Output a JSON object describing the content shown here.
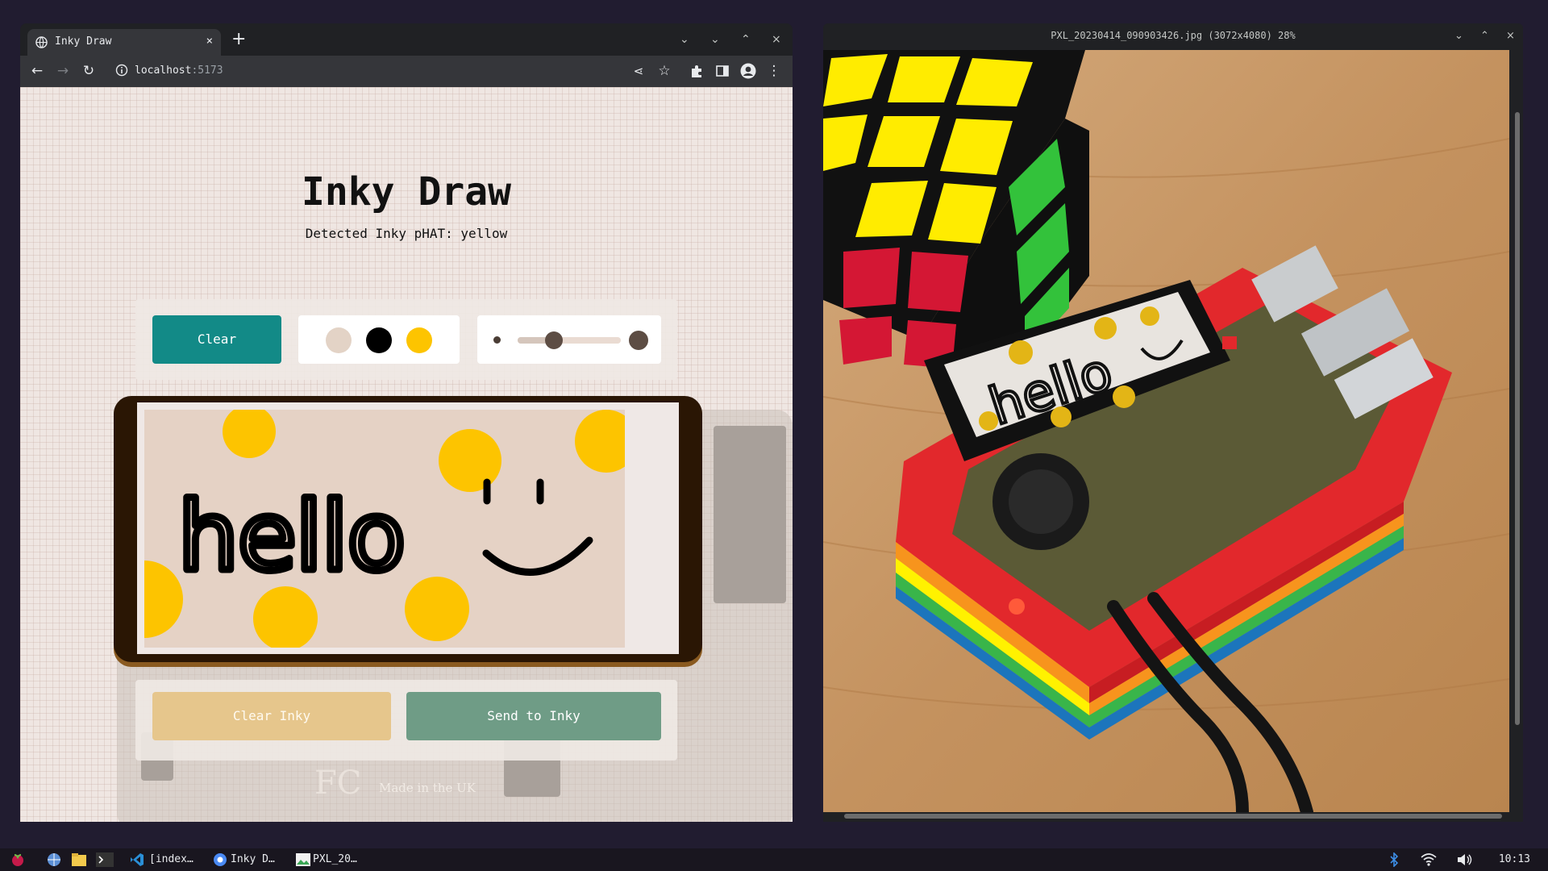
{
  "browser": {
    "tab_title": "Inky Draw",
    "tab_close": "×",
    "new_tab": "+",
    "url_host": "localhost",
    "url_port": ":5173",
    "window_controls": [
      "⌄",
      "⌄",
      "⌃",
      "×"
    ]
  },
  "app": {
    "title": "Inky Draw",
    "subtitle": "Detected Inky pHAT: yellow",
    "clear_label": "Clear",
    "palette": [
      {
        "name": "background",
        "color": "#e3d3c6"
      },
      {
        "name": "black",
        "color": "#000000"
      },
      {
        "name": "yellow",
        "color": "#fdc400"
      }
    ],
    "brush_size_level": 0.35,
    "clear_inky_label": "Clear Inky",
    "send_label": "Send to Inky",
    "drawing_text": "hello",
    "background_print": "Made in the UK",
    "background_mark": "FC"
  },
  "viewer": {
    "title": "PXL_20230414_090903426.jpg (3072x4080) 28%",
    "window_controls": [
      "⌄",
      "⌃",
      "×"
    ],
    "photo_screen_text": "hello"
  },
  "taskbar": {
    "items": [
      "[index…",
      "Inky D…",
      "PXL_20…"
    ],
    "clock": "10:13"
  },
  "colors": {
    "accent_teal": "#128a87",
    "clear_inky": "#e6c68c",
    "send_green": "#6f9c86",
    "device_frame": "#2a1604"
  }
}
